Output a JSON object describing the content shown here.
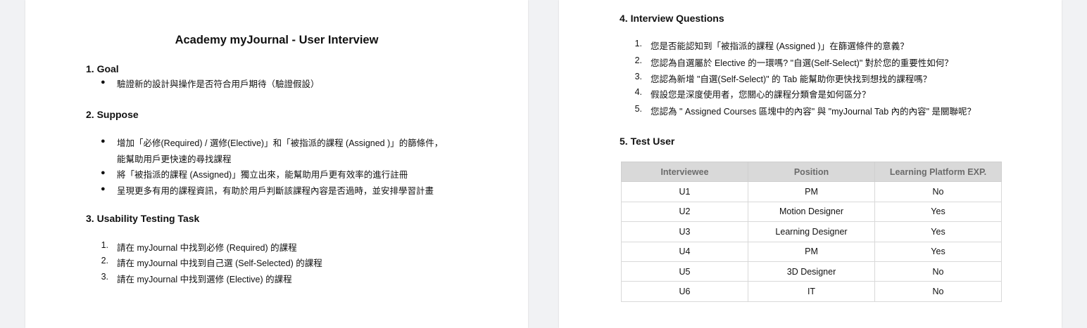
{
  "title": "Academy myJournal - User Interview",
  "goal": {
    "heading": "1. Goal",
    "items": [
      "驗證新的設計與操作是否符合用戶期待（驗證假設）"
    ]
  },
  "suppose": {
    "heading": "2. Suppose",
    "items": [
      {
        "lines": [
          "增加「必修(Required) / 選修(Elective)」和「被指派的課程 (Assigned )」的篩條件，",
          "能幫助用戶更快速的尋找課程"
        ]
      },
      {
        "lines": [
          "將「被指派的課程 (Assigned)」獨立出來，能幫助用戶更有效率的進行註冊"
        ]
      },
      {
        "lines": [
          "呈現更多有用的課程資訊，有助於用戶判斷該課程內容是否過時，並安排學習計畫"
        ]
      }
    ]
  },
  "task": {
    "heading": "3. Usability Testing Task",
    "items": [
      "請在 myJournal 中找到必修 (Required) 的課程",
      "請在 myJournal 中找到自己選 (Self-Selected) 的課程",
      "請在 myJournal 中找到選修 (Elective) 的課程"
    ]
  },
  "questions": {
    "heading": "4. Interview Questions",
    "items": [
      "您是否能認知到「被指派的課程 (Assigned )」在篩選條件的意義？",
      "您認為自選屬於 Elective 的一環嗎? \"自選(Self-Select)\" 對於您的重要性如何？",
      "您認為新增 \"自選(Self-Select)\" 的 Tab 能幫助你更快找到想找的課程嗎？",
      "假設您是深度使用者，您關心的課程分類會是如何區分？",
      "您認為 \" Assigned Courses 區塊中的內容\" 與 \"myJournal Tab 內的內容\" 是關聯呢？"
    ]
  },
  "test_user": {
    "heading": "5. Test User",
    "columns": [
      "Interviewee",
      "Position",
      "Learning Platform EXP."
    ],
    "rows": [
      [
        "U1",
        "PM",
        "No"
      ],
      [
        "U2",
        "Motion Designer",
        "Yes"
      ],
      [
        "U3",
        "Learning Designer",
        "Yes"
      ],
      [
        "U4",
        "PM",
        "Yes"
      ],
      [
        "U5",
        "3D Designer",
        "No"
      ],
      [
        "U6",
        "IT",
        "No"
      ]
    ]
  },
  "markers": {
    "bullet": "●",
    "numbers": [
      "1.",
      "2.",
      "3.",
      "4.",
      "5."
    ]
  }
}
